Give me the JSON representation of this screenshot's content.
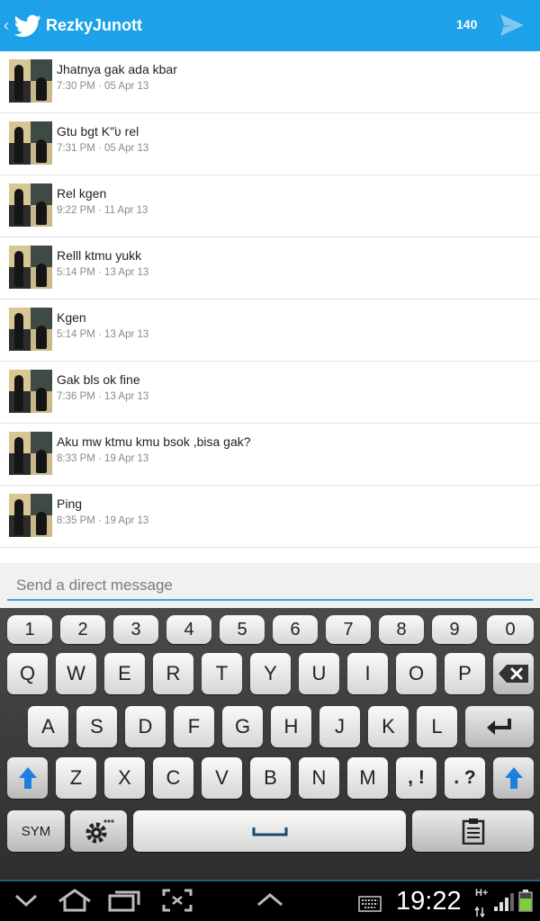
{
  "header": {
    "back_glyph": "‹",
    "title": "RezkyJunott",
    "char_count": "140",
    "accent": "#1da1e8"
  },
  "messages": [
    {
      "text": "Jhatnya gak ada kbar",
      "time": "7:30 PM · 05 Apr 13"
    },
    {
      "text": "Gtu bgt K\"̈ʋ  rel",
      "time": "7:31 PM · 05 Apr 13"
    },
    {
      "text": "Rel kgen",
      "time": "9:22 PM · 11 Apr 13"
    },
    {
      "text": "Relll ktmu yukk",
      "time": "5:14 PM · 13 Apr 13"
    },
    {
      "text": "Kgen",
      "time": "5:14 PM · 13 Apr 13"
    },
    {
      "text": "Gak bls ok fine",
      "time": "7:36 PM · 13 Apr 13"
    },
    {
      "text": "Aku mw ktmu kmu bsok ,bisa gak?",
      "time": "8:33 PM · 19 Apr 13"
    },
    {
      "text": "Ping",
      "time": "8:35 PM · 19 Apr 13"
    }
  ],
  "compose": {
    "placeholder": "Send a direct message"
  },
  "keyboard": {
    "numbers": [
      "1",
      "2",
      "3",
      "4",
      "5",
      "6",
      "7",
      "8",
      "9",
      "0"
    ],
    "row1": [
      "Q",
      "W",
      "E",
      "R",
      "T",
      "Y",
      "U",
      "I",
      "O",
      "P"
    ],
    "row2": [
      "A",
      "S",
      "D",
      "F",
      "G",
      "H",
      "J",
      "K",
      "L"
    ],
    "row3": [
      "Z",
      "X",
      "C",
      "V",
      "B",
      "N",
      "M"
    ],
    "comma_key": ", !",
    "period_key": ". ?",
    "sym_label": "SYM",
    "space_glyph": "␣"
  },
  "statusbar": {
    "time": "19:22",
    "network": "H+"
  }
}
